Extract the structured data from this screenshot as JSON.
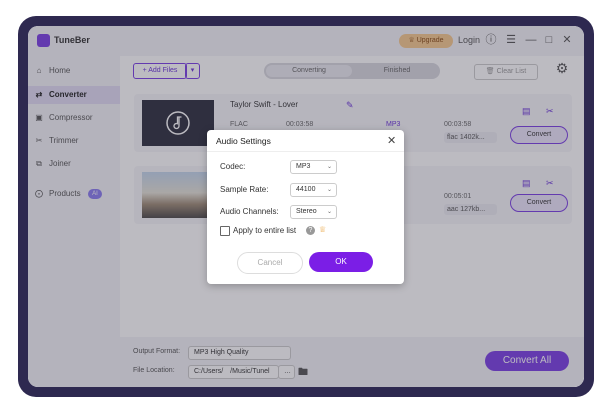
{
  "app": {
    "name": "TuneBer",
    "upgrade_label": "Upgrade",
    "login_label": "Login"
  },
  "titlebar_icons": [
    "help-icon",
    "menu-icon",
    "minimize-icon",
    "maximize-icon",
    "close-icon"
  ],
  "sidebar": {
    "items": [
      {
        "label": "Home",
        "icon": "home-icon",
        "active": false
      },
      {
        "label": "Converter",
        "icon": "converter-icon",
        "active": true
      },
      {
        "label": "Compressor",
        "icon": "compressor-icon",
        "active": false
      },
      {
        "label": "Trimmer",
        "icon": "trimmer-icon",
        "active": false
      },
      {
        "label": "Joiner",
        "icon": "joiner-icon",
        "active": false
      },
      {
        "label": "Products",
        "icon": "products-icon",
        "active": false,
        "badge": "AI"
      }
    ]
  },
  "toolbar": {
    "add_files_label": "+ Add Files",
    "tabs": [
      {
        "label": "Converting",
        "selected": true
      },
      {
        "label": "Finished",
        "selected": false
      }
    ],
    "clear_list_label": "Clear List"
  },
  "files": [
    {
      "title": "Taylor Swift - Lover",
      "src_format": "FLAC",
      "src_duration": "00:03:58",
      "out_format": "MP3",
      "out_duration": "00:03:58",
      "out_option": "flac 1402k...",
      "convert_label": "Convert"
    },
    {
      "title": "",
      "out_duration": "00:05:01",
      "out_option": "aac 127kb...",
      "convert_label": "Convert"
    }
  ],
  "footer": {
    "output_format_label": "Output Format:",
    "output_format_value": "MP3 High Quality",
    "file_location_label": "File Location:",
    "file_location_value": "C:/Users/ /Music/Tunel",
    "more_label": "…",
    "convert_all_label": "Convert All"
  },
  "dialog": {
    "title": "Audio Settings",
    "codec_label": "Codec:",
    "codec_value": "MP3",
    "sample_rate_label": "Sample Rate:",
    "sample_rate_value": "44100",
    "channels_label": "Audio Channels:",
    "channels_value": "Stereo",
    "apply_label": "Apply to entire list",
    "apply_checked": false,
    "cancel_label": "Cancel",
    "ok_label": "OK"
  },
  "colors": {
    "accent": "#7b3fe4",
    "frame": "#2e2950",
    "upgrade_bg": "#f6c98e"
  }
}
